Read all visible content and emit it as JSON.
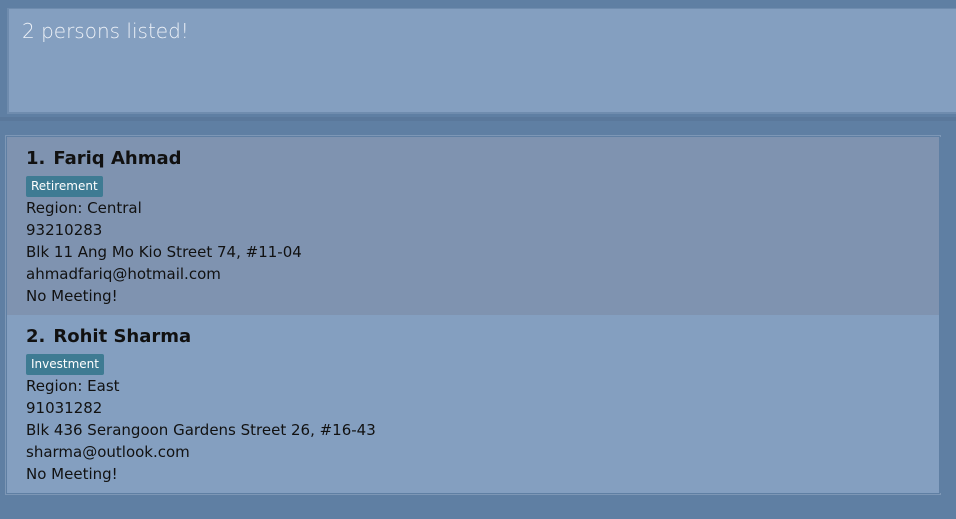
{
  "result_display": {
    "text": "2 persons listed!"
  },
  "persons": [
    {
      "index": "1.",
      "name": "Fariq Ahmad",
      "tag": "Retirement",
      "region": "Region: Central",
      "phone": "93210283",
      "address": "Blk 11 Ang Mo Kio Street 74, #11-04",
      "email": "ahmadfariq@hotmail.com",
      "meeting": "No Meeting!"
    },
    {
      "index": "2.",
      "name": "Rohit Sharma",
      "tag": "Investment",
      "region": "Region: East",
      "phone": "91031282",
      "address": "Blk 436 Serangoon Gardens Street 26, #16-43",
      "email": "sharma@outlook.com",
      "meeting": "No Meeting!"
    }
  ],
  "colors": {
    "background": "#5f7fa3",
    "panel": "#849fc0",
    "selected_card": "#7f93b0",
    "tag": "#3e7b93"
  }
}
